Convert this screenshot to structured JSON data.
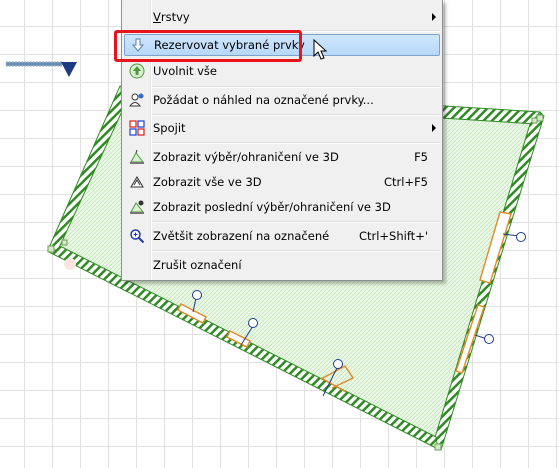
{
  "colors": {
    "highlight_border": "#e8141c",
    "menu_hover_bg": "#c4dffb",
    "wall_hatch": "#2e8b22",
    "floor_fill": "#e8f6e4",
    "marker_blue": "#1f3b8f"
  },
  "menu": {
    "items": [
      {
        "id": "vrstvy",
        "label": "Vrstvy",
        "shortcut": "",
        "icon": "none",
        "submenu": true
      },
      {
        "id": "rezervovat",
        "label": "Rezervovat vybrané prvky",
        "shortcut": "",
        "icon": "reserve-arrow-icon",
        "highlighted": true
      },
      {
        "id": "uvolnit",
        "label": "Uvolnit vše",
        "shortcut": "",
        "icon": "release-up-arrow-icon"
      },
      {
        "id": "pozadat",
        "label": "Požádat o náhled na označené prvky...",
        "shortcut": "",
        "icon": "request-preview-icon"
      },
      {
        "id": "spojit",
        "label": "Spojit",
        "shortcut": "",
        "icon": "connect-icon",
        "submenu": true
      },
      {
        "id": "zobrazit-vyber",
        "label": "Zobrazit výběr/ohraničení ve 3D",
        "shortcut": "F5",
        "icon": "show-selection-3d-icon"
      },
      {
        "id": "zobrazit-vse",
        "label": "Zobrazit vše ve 3D",
        "shortcut": "Ctrl+F5",
        "icon": "show-all-3d-icon"
      },
      {
        "id": "zobrazit-posledni",
        "label": "Zobrazit poslední výběr/ohraničení ve 3D",
        "shortcut": "",
        "icon": "show-last-3d-icon"
      },
      {
        "id": "zvetsit",
        "label": "Zvětšit zobrazení na označené",
        "shortcut": "Ctrl+Shift+'",
        "icon": "zoom-to-selection-icon"
      },
      {
        "id": "zrusit",
        "label": "Zrušit označení",
        "shortcut": "",
        "icon": "none"
      }
    ]
  }
}
